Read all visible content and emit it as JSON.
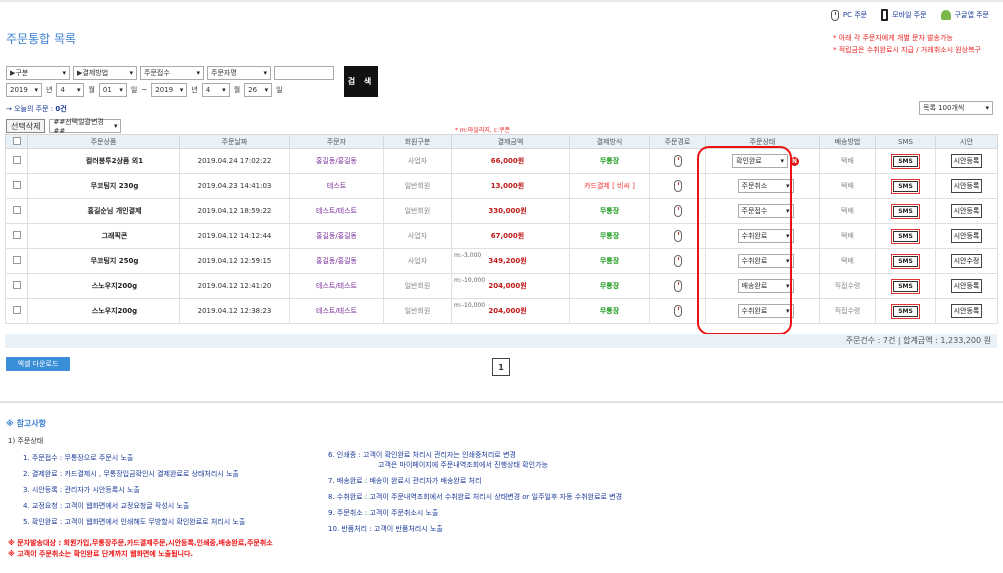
{
  "page_title": "주문통합 목록",
  "top_links": [
    {
      "label": "PC 주문",
      "icon": "mouse-icon"
    },
    {
      "label": "모바일 주문",
      "icon": "phone-icon"
    },
    {
      "label": "구글앱 주문",
      "icon": "android-icon"
    }
  ],
  "notes_top": [
    "* 아래 각 주문자에게 개별 문자 발송가능",
    "* 적립금은 수취완료시 지급 / 거래취소시 원상복구"
  ],
  "filter": {
    "type_select": "▶구분",
    "payment_select": "▶결제방법",
    "status_select": "주문접수",
    "orderer_select": "주문자명",
    "keyword_value": "",
    "search_label": "검 색",
    "from_year": "2019",
    "from_month": "4",
    "from_day": "01",
    "to_year": "2019",
    "to_month": "4",
    "to_day": "26",
    "year_unit": "년",
    "month_unit": "월",
    "day_unit": "일",
    "tilde": "~"
  },
  "today_orders": {
    "label": "→ 오늘의 주문 :",
    "count": "0건"
  },
  "list_count_select": "목록 100개씩",
  "batch": {
    "delete_label": "선택삭제",
    "change_select": "##선택일괄변경##"
  },
  "legend": "* m:마일리지, c:쿠폰",
  "columns": [
    "",
    "주문상품",
    "주문날짜",
    "주문자",
    "회원구분",
    "결제금액",
    "결제방식",
    "주문경로",
    "주문상태",
    "배송방법",
    "SMS",
    "시안"
  ],
  "orders": [
    {
      "product": "컬러봉투2상품 외1",
      "date": "2019.04.24 17:02:22",
      "orderer": "홍길동/홍길동",
      "member": "사업자",
      "mileage": "",
      "amount": "66,000원",
      "payment": "무통장",
      "status": "확인완료",
      "badge": "N",
      "delivery": "택배",
      "sms": "SMS",
      "sian": "시안등록"
    },
    {
      "product": "무코팅지 230g",
      "date": "2019.04.23 14:41:03",
      "orderer": "테스트",
      "member": "일반회원",
      "mileage": "",
      "amount": "13,000원",
      "payment": "카드결제 [ 비씨 ]",
      "status": "주문취소",
      "badge": "",
      "delivery": "택배",
      "sms": "SMS",
      "sian": "시안등록"
    },
    {
      "product": "홍길순님 개인결제",
      "date": "2019.04.12 18:59:22",
      "orderer": "테스트/테스트",
      "member": "일반회원",
      "mileage": "",
      "amount": "330,000원",
      "payment": "무통장",
      "status": "주문접수",
      "badge": "",
      "delivery": "택배",
      "sms": "SMS",
      "sian": "시안등록"
    },
    {
      "product": "그래픽콘",
      "date": "2019.04.12 14:12:44",
      "orderer": "홍길동/홍길동",
      "member": "사업자",
      "mileage": "",
      "amount": "67,000원",
      "payment": "무통장",
      "status": "수취완료",
      "badge": "",
      "delivery": "택배",
      "sms": "SMS",
      "sian": "시안등록"
    },
    {
      "product": "무코팅지 250g",
      "date": "2019.04.12 12:59:15",
      "orderer": "홍길동/홍길동",
      "member": "사업자",
      "mileage": "m:-3,000",
      "amount": "349,200원",
      "payment": "무통장",
      "status": "수취완료",
      "badge": "",
      "delivery": "택배",
      "sms": "SMS",
      "sian": "시안수정"
    },
    {
      "product": "스노우지200g",
      "date": "2019.04.12 12:41:20",
      "orderer": "테스트/테스트",
      "member": "일반회원",
      "mileage": "m:-10,000",
      "amount": "204,000원",
      "payment": "무통장",
      "status": "배송완료",
      "badge": "",
      "delivery": "직접수령",
      "sms": "SMS",
      "sian": "시안등록"
    },
    {
      "product": "스노우지200g",
      "date": "2019.04.12 12:38:23",
      "orderer": "테스트/테스트",
      "member": "일반회원",
      "mileage": "m:-10,000",
      "amount": "204,000원",
      "payment": "무통장",
      "status": "수취완료",
      "badge": "",
      "delivery": "직접수령",
      "sms": "SMS",
      "sian": "시안등록"
    }
  ],
  "totals": "주문건수 : 7건 | 합계금액 : 1,233,200 원",
  "excel_label": "엑셀 다운로드",
  "page_number": "1",
  "ref": {
    "title": "※ 참고사항",
    "subtitle": "1) 주문상태",
    "left": [
      "1. 주문접수 :  무통장으로 주문시 노출",
      "2. 결제완료 :  카드결제시 , 무통장입금확인시 결제완료로 상태처리시 노출",
      "3. 시안등록 :  관리자가 시안등록시 노출",
      "4. 교정요청 :  고객이 웹화면에서 교정요청글 작성시 노출",
      "5. 확인완료 :  고객이 웹화면에서 인쇄해도 무방할시 확인완료로 처리시 노출"
    ],
    "right": [
      "6. 인쇄중 :    고객이 확인완료 처리시 관리자는 인쇄중처리로 변경",
      "고객은 마이페이지에 주문내역조회에서 진행상태 확인가능",
      "7. 배송완료 :  배송이 완료시 관리자가 배송완료 처리",
      "8. 수취완료 :  고객이 주문내역조회에서 수취완료 처리시 상태변경 or 일주일후 자동 수취완료로 변경",
      "9. 주문취소 :  고객이 주문취소시 노출",
      "10. 반품처리 : 고객이 반품처리시 노출"
    ]
  },
  "warnings": [
    "※ 문자발송대상 : 회원가입,무통장주문,카드결제주문,시안등록,인쇄중,배송완료,주문취소",
    "※ 고객이 주문취소는 확인완료 단계까지 웹화면에 노출됩니다."
  ]
}
